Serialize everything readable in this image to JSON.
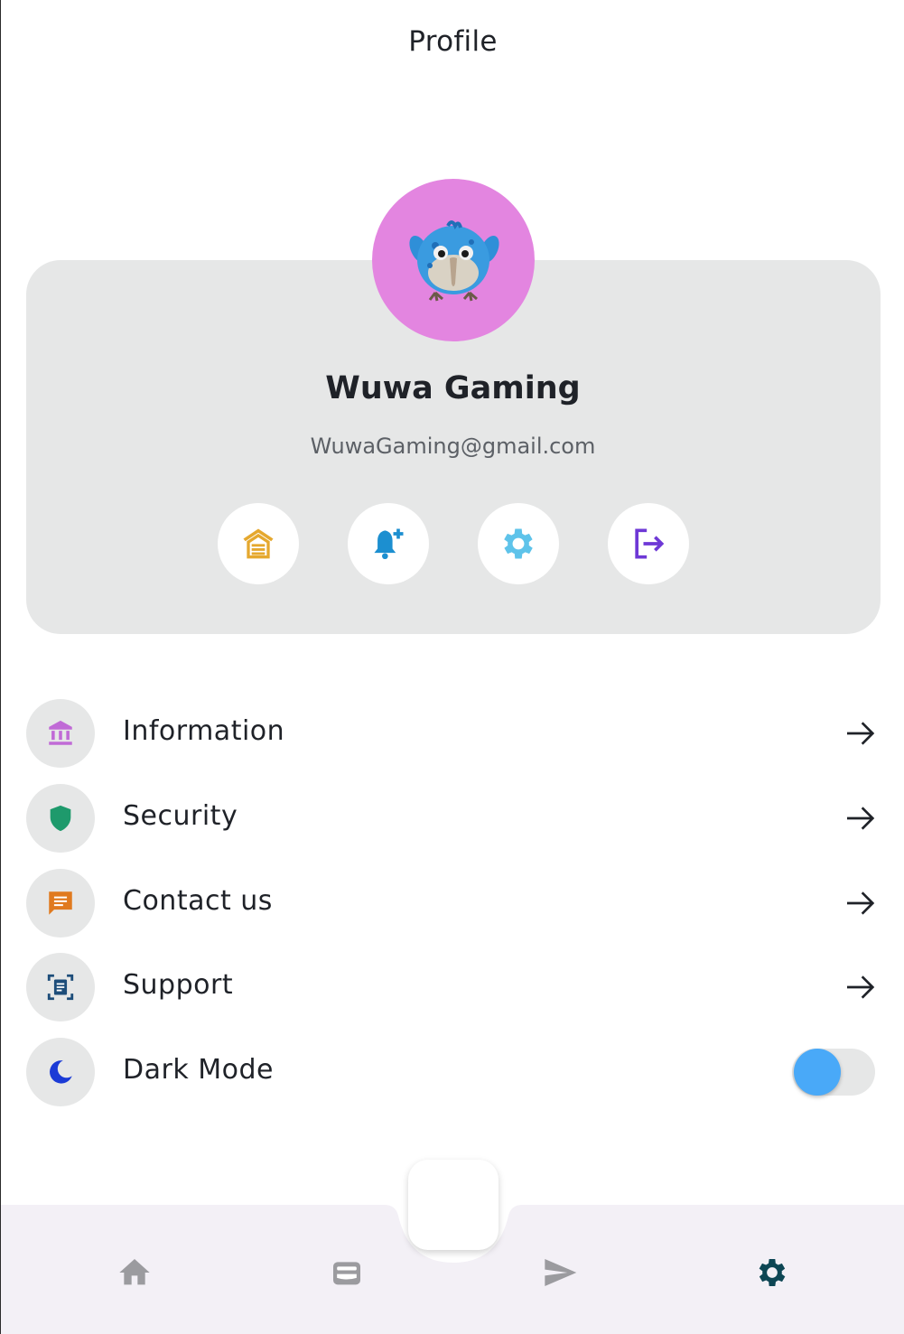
{
  "header": {
    "title": "Profile"
  },
  "profile": {
    "name": "Wuwa Gaming",
    "email": "WuwaGaming@gmail.com",
    "avatar_bg": "#e385e0"
  },
  "quick_actions": [
    {
      "icon": "home-icon",
      "color": "#e5a82e"
    },
    {
      "icon": "bell-add-icon",
      "color": "#1c8fd0"
    },
    {
      "icon": "gear-icon",
      "color": "#5ec3ea"
    },
    {
      "icon": "logout-icon",
      "color": "#6e38d6"
    }
  ],
  "menu": [
    {
      "label": "Information",
      "icon": "bank-icon",
      "color": "#c06ad6"
    },
    {
      "label": "Security",
      "icon": "shield-icon",
      "color": "#1e9a6c"
    },
    {
      "label": "Contact us",
      "icon": "message-icon",
      "color": "#e07a1f"
    },
    {
      "label": "Support",
      "icon": "document-scan-icon",
      "color": "#1d4d7a"
    },
    {
      "label": "Dark Mode",
      "icon": "moon-icon",
      "color": "#1b3bd6",
      "toggle_on": true
    }
  ],
  "bottom_nav": [
    {
      "icon": "home-icon",
      "active": false
    },
    {
      "icon": "wallet-icon",
      "active": false
    },
    {
      "icon": "send-icon",
      "active": false
    },
    {
      "icon": "gear-icon",
      "active": true
    }
  ],
  "colors": {
    "card_bg": "#e6e7e7",
    "toggle_knob": "#49a9f8",
    "nav_bg": "#f3f0f6",
    "nav_inactive": "#9b9b9f",
    "nav_active": "#0d4654"
  }
}
